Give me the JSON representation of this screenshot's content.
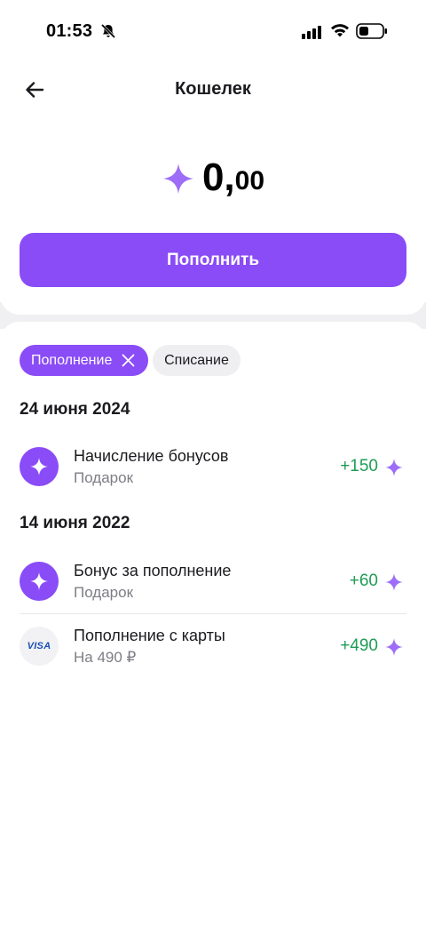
{
  "status_bar": {
    "time": "01:53"
  },
  "header": {
    "title": "Кошелек"
  },
  "balance": {
    "integer": "0,",
    "fraction": "00"
  },
  "topup_button": {
    "label": "Пополнить"
  },
  "filters": [
    {
      "label": "Пополнение",
      "active": true
    },
    {
      "label": "Списание",
      "active": false
    }
  ],
  "groups": [
    {
      "date": "24 июня 2024",
      "items": [
        {
          "icon": "sparkle-icon",
          "title": "Начисление бонусов",
          "subtitle": "Подарок",
          "amount": "+150"
        }
      ]
    },
    {
      "date": "14 июня 2022",
      "items": [
        {
          "icon": "sparkle-icon",
          "title": "Бонус за пополнение",
          "subtitle": "Подарок",
          "amount": "+60"
        },
        {
          "icon": "visa-icon",
          "icon_text": "VISA",
          "title": "Пополнение с карты",
          "subtitle": "На 490 ₽",
          "amount": "+490"
        }
      ]
    }
  ],
  "colors": {
    "accent": "#8a4cf6",
    "positive": "#1f9d55",
    "secondary_text": "#7d7d85",
    "chip_bg": "#efeff2",
    "section_bg": "#f0f0f3"
  }
}
